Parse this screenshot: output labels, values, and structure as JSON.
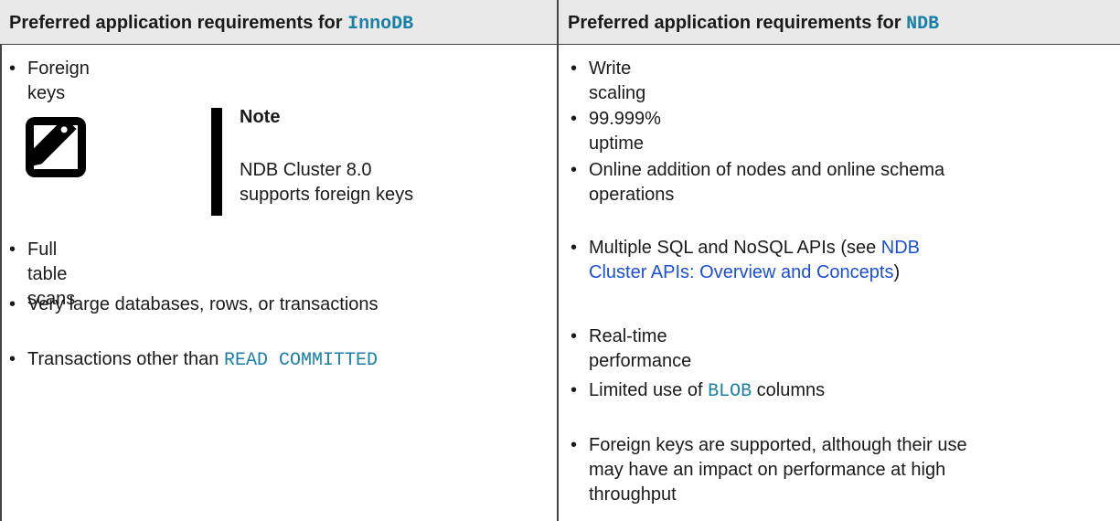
{
  "headers": {
    "left_prefix": "Preferred application requirements for ",
    "left_code": "InnoDB",
    "right_prefix": "Preferred application requirements for ",
    "right_code": "NDB"
  },
  "left_items": [
    {
      "text": "Foreign keys"
    },
    {
      "text": "Full table scans"
    },
    {
      "text": "Very large databases, rows, or transactions"
    },
    {
      "prefix": "Transactions other than ",
      "code": "READ COMMITTED"
    }
  ],
  "note": {
    "icon": "note-icon",
    "title": "Note",
    "line1": "NDB Cluster 8.0",
    "line2": "supports foreign keys"
  },
  "right_items": [
    {
      "text": "Write scaling"
    },
    {
      "text": "99.999% uptime"
    },
    {
      "line1": "Online addition of nodes and online schema",
      "line2": "operations"
    },
    {
      "prefix": "Multiple SQL and NoSQL APIs (see ",
      "link_line1": "NDB",
      "link_line2": "Cluster APIs: Overview and Concepts",
      "suffix": ")"
    },
    {
      "text": "Real-time performance"
    },
    {
      "prefix": "Limited use of ",
      "code": "BLOB",
      "suffix": " columns"
    },
    {
      "line1": "Foreign keys are supported, although their use",
      "line2": "may have an impact on performance at high",
      "line3": "throughput"
    }
  ],
  "bullet_char": "•",
  "colors": {
    "code": "#1a7fa6",
    "link": "#1a4fd6",
    "header_bg": "#e9e9e9"
  }
}
